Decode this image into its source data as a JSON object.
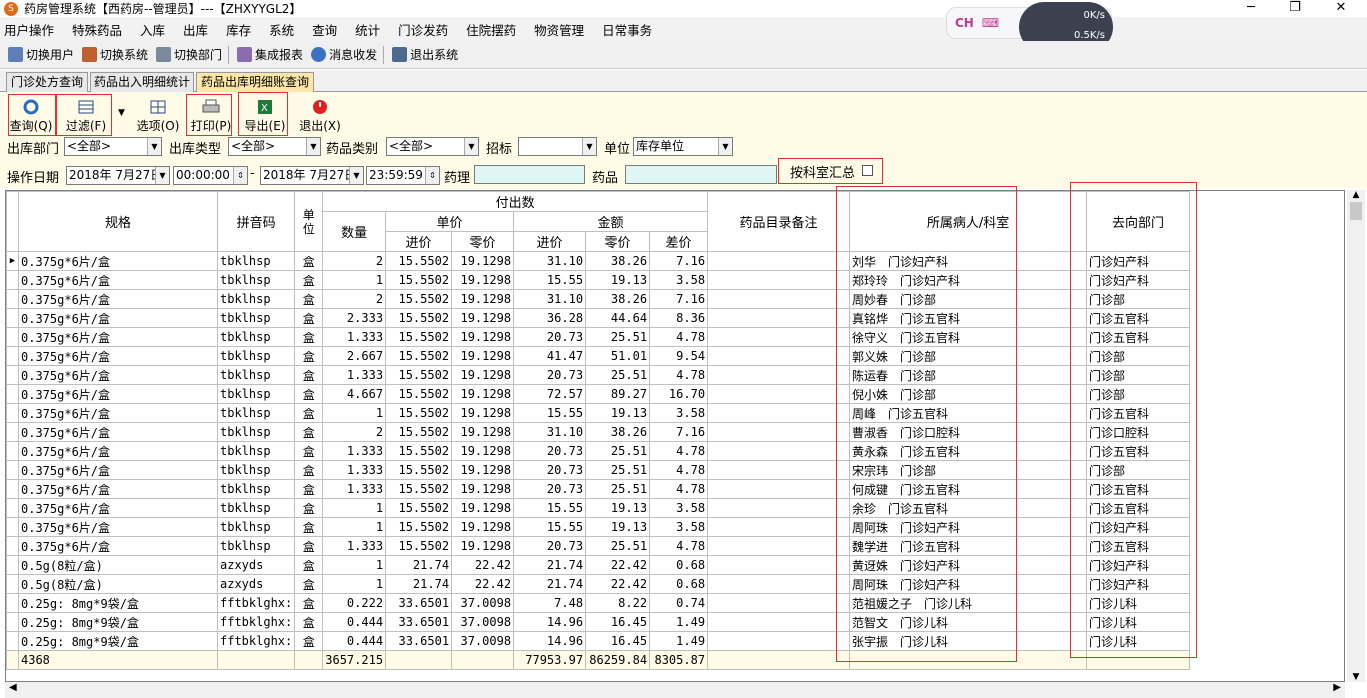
{
  "window": {
    "title": "药房管理系统【西药房--管理员】---【ZHXYYGL2】"
  },
  "menu": [
    "用户操作",
    "特殊药品",
    "入库",
    "出库",
    "库存",
    "系统",
    "查询",
    "统计",
    "门诊发药",
    "住院摆药",
    "物资管理",
    "日常事务"
  ],
  "ime": {
    "label": "CH",
    "down": "0K/s",
    "up": "0.5K/s"
  },
  "toolbar": [
    "切换用户",
    "切换系统",
    "切换部门",
    "集成报表",
    "消息收发",
    "退出系统"
  ],
  "tabs": [
    "门诊处方查询",
    "药品出入明细统计",
    "药品出库明细账查询"
  ],
  "actions": {
    "query": "查询(Q)",
    "filter": "过滤(F)",
    "options": "选项(O)",
    "print": "打印(P)",
    "export": "导出(E)",
    "exit": "退出(X)"
  },
  "filters": {
    "dept_label": "出库部门",
    "dept_value": "<全部>",
    "type_label": "出库类型",
    "type_value": "<全部>",
    "category_label": "药品类别",
    "category_value": "<全部>",
    "bid_label": "招标",
    "bid_value": "",
    "unit_label": "单位",
    "unit_value": "库存单位",
    "date_label": "操作日期",
    "date_from": "2018年 7月27日",
    "time_from": "00:00:00",
    "date_to": "2018年 7月27日",
    "time_to": "23:59:59",
    "pharmacology_label": "药理",
    "drug_label": "药品",
    "summary_label": "按科室汇总"
  },
  "headers": {
    "spec": "规格",
    "pinyin": "拼音码",
    "unit": "单位",
    "paid": "付出数",
    "qty": "数量",
    "unit_price": "单价",
    "amount": "金额",
    "in_price": "进价",
    "retail": "零价",
    "amt_in": "进价",
    "amt_retail": "零价",
    "diff": "差价",
    "remark": "药品目录备注",
    "patient": "所属病人/科室",
    "dest": "去向部门"
  },
  "rows": [
    [
      "0.375g*6片/盒",
      "tbklhsp",
      "盒",
      "2",
      "15.5502",
      "19.1298",
      "31.10",
      "38.26",
      "7.16",
      "",
      "刘华　门诊妇产科",
      "门诊妇产科"
    ],
    [
      "0.375g*6片/盒",
      "tbklhsp",
      "盒",
      "1",
      "15.5502",
      "19.1298",
      "15.55",
      "19.13",
      "3.58",
      "",
      "郑玲玲　门诊妇产科",
      "门诊妇产科"
    ],
    [
      "0.375g*6片/盒",
      "tbklhsp",
      "盒",
      "2",
      "15.5502",
      "19.1298",
      "31.10",
      "38.26",
      "7.16",
      "",
      "周妙春　门诊部",
      "门诊部"
    ],
    [
      "0.375g*6片/盒",
      "tbklhsp",
      "盒",
      "2.333",
      "15.5502",
      "19.1298",
      "36.28",
      "44.64",
      "8.36",
      "",
      "真铭烨　门诊五官科",
      "门诊五官科"
    ],
    [
      "0.375g*6片/盒",
      "tbklhsp",
      "盒",
      "1.333",
      "15.5502",
      "19.1298",
      "20.73",
      "25.51",
      "4.78",
      "",
      "徐守义　门诊五官科",
      "门诊五官科"
    ],
    [
      "0.375g*6片/盒",
      "tbklhsp",
      "盒",
      "2.667",
      "15.5502",
      "19.1298",
      "41.47",
      "51.01",
      "9.54",
      "",
      "郭义姝　门诊部",
      "门诊部"
    ],
    [
      "0.375g*6片/盒",
      "tbklhsp",
      "盒",
      "1.333",
      "15.5502",
      "19.1298",
      "20.73",
      "25.51",
      "4.78",
      "",
      "陈运春　门诊部",
      "门诊部"
    ],
    [
      "0.375g*6片/盒",
      "tbklhsp",
      "盒",
      "4.667",
      "15.5502",
      "19.1298",
      "72.57",
      "89.27",
      "16.70",
      "",
      "倪小姝　门诊部",
      "门诊部"
    ],
    [
      "0.375g*6片/盒",
      "tbklhsp",
      "盒",
      "1",
      "15.5502",
      "19.1298",
      "15.55",
      "19.13",
      "3.58",
      "",
      "周峰　门诊五官科",
      "门诊五官科"
    ],
    [
      "0.375g*6片/盒",
      "tbklhsp",
      "盒",
      "2",
      "15.5502",
      "19.1298",
      "31.10",
      "38.26",
      "7.16",
      "",
      "曹淑香　门诊口腔科",
      "门诊口腔科"
    ],
    [
      "0.375g*6片/盒",
      "tbklhsp",
      "盒",
      "1.333",
      "15.5502",
      "19.1298",
      "20.73",
      "25.51",
      "4.78",
      "",
      "黄永森　门诊五官科",
      "门诊五官科"
    ],
    [
      "0.375g*6片/盒",
      "tbklhsp",
      "盒",
      "1.333",
      "15.5502",
      "19.1298",
      "20.73",
      "25.51",
      "4.78",
      "",
      "宋宗玮　门诊部",
      "门诊部"
    ],
    [
      "0.375g*6片/盒",
      "tbklhsp",
      "盒",
      "1.333",
      "15.5502",
      "19.1298",
      "20.73",
      "25.51",
      "4.78",
      "",
      "何成键　门诊五官科",
      "门诊五官科"
    ],
    [
      "0.375g*6片/盒",
      "tbklhsp",
      "盒",
      "1",
      "15.5502",
      "19.1298",
      "15.55",
      "19.13",
      "3.58",
      "",
      "余珍　门诊五官科",
      "门诊五官科"
    ],
    [
      "0.375g*6片/盒",
      "tbklhsp",
      "盒",
      "1",
      "15.5502",
      "19.1298",
      "15.55",
      "19.13",
      "3.58",
      "",
      "周阿珠　门诊妇产科",
      "门诊妇产科"
    ],
    [
      "0.375g*6片/盒",
      "tbklhsp",
      "盒",
      "1.333",
      "15.5502",
      "19.1298",
      "20.73",
      "25.51",
      "4.78",
      "",
      "魏学进　门诊五官科",
      "门诊五官科"
    ],
    [
      "0.5g(8粒/盒)",
      "azxyds",
      "盒",
      "1",
      "21.74",
      "22.42",
      "21.74",
      "22.42",
      "0.68",
      "",
      "黄迓姝　门诊妇产科",
      "门诊妇产科"
    ],
    [
      "0.5g(8粒/盒)",
      "azxyds",
      "盒",
      "1",
      "21.74",
      "22.42",
      "21.74",
      "22.42",
      "0.68",
      "",
      "周阿珠　门诊妇产科",
      "门诊妇产科"
    ],
    [
      "0.25g: 8mg*9袋/盒",
      "fftbklghx:",
      "盒",
      "0.222",
      "33.6501",
      "37.0098",
      "7.48",
      "8.22",
      "0.74",
      "",
      "范祖媛之子　门诊儿科",
      "门诊儿科"
    ],
    [
      "0.25g: 8mg*9袋/盒",
      "fftbklghx:",
      "盒",
      "0.444",
      "33.6501",
      "37.0098",
      "14.96",
      "16.45",
      "1.49",
      "",
      "范智文　门诊儿科",
      "门诊儿科"
    ],
    [
      "0.25g: 8mg*9袋/盒",
      "fftbklghx:",
      "盒",
      "0.444",
      "33.6501",
      "37.0098",
      "14.96",
      "16.45",
      "1.49",
      "",
      "张宇振　门诊儿科",
      "门诊儿科"
    ]
  ],
  "summary": {
    "count": "4368",
    "qty": "3657.215",
    "amt_in": "77953.97",
    "amt_retail": "86259.84",
    "diff": "8305.87"
  }
}
